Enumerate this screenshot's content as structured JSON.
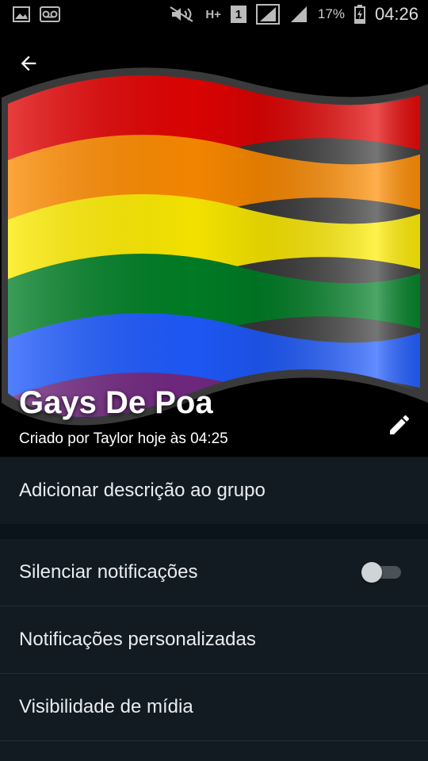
{
  "status_bar": {
    "battery_percent": "17%",
    "time": "04:26",
    "network_type": "H+",
    "sim_slot": "1"
  },
  "group": {
    "name": "Gays De Poa",
    "created_by": "Criado por Taylor hoje às 04:25"
  },
  "description_row": {
    "label": "Adicionar descrição ao grupo"
  },
  "settings": {
    "items": [
      {
        "label": "Silenciar notificações",
        "toggle_on": false
      },
      {
        "label": "Notificações personalizadas"
      },
      {
        "label": "Visibilidade de mídia"
      }
    ]
  },
  "colors": {
    "header_bg": "#000000",
    "row_bg": "#121b22",
    "text": "#e9edef",
    "flag_stripes": [
      "#e40303",
      "#ff8c00",
      "#ffed00",
      "#008026",
      "#1f5bff",
      "#732982"
    ]
  }
}
